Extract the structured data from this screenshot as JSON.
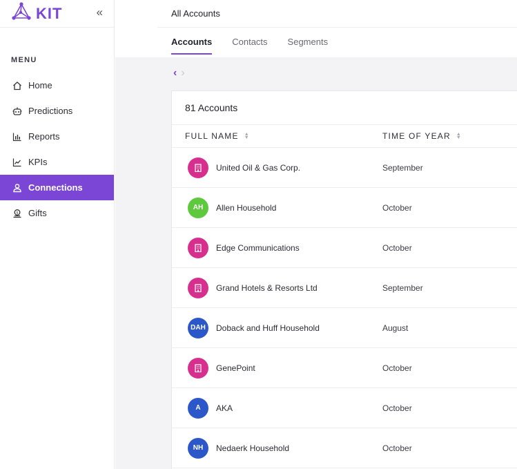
{
  "brand": {
    "name": "KIT",
    "collapse_glyph": "«"
  },
  "sidebar": {
    "menu_title": "MENU",
    "items": [
      {
        "label": "Home",
        "icon": "home-icon"
      },
      {
        "label": "Predictions",
        "icon": "robot-icon"
      },
      {
        "label": "Reports",
        "icon": "bar-chart-icon"
      },
      {
        "label": "KPIs",
        "icon": "trend-line-icon"
      },
      {
        "label": "Connections",
        "icon": "user-icon",
        "active": true
      },
      {
        "label": "Gifts",
        "icon": "gift-icon"
      }
    ]
  },
  "header": {
    "title": "All Accounts",
    "tabs": [
      {
        "label": "Accounts",
        "active": true
      },
      {
        "label": "Contacts"
      },
      {
        "label": "Segments"
      }
    ]
  },
  "pager": {
    "prev": "‹",
    "next": "›"
  },
  "table": {
    "title": "81 Accounts",
    "columns": {
      "name": "FULL NAME",
      "time": "TIME OF YEAR"
    },
    "rows": [
      {
        "name": "United Oil & Gas Corp.",
        "time": "September",
        "avatar": "",
        "avatar_type": "account"
      },
      {
        "name": "Allen Household",
        "time": "October",
        "avatar": "AH",
        "avatar_type": "green"
      },
      {
        "name": "Edge Communications",
        "time": "October",
        "avatar": "",
        "avatar_type": "account"
      },
      {
        "name": "Grand Hotels & Resorts Ltd",
        "time": "September",
        "avatar": "",
        "avatar_type": "account"
      },
      {
        "name": "Doback and Huff Household",
        "time": "August",
        "avatar": "DAH",
        "avatar_type": "blue"
      },
      {
        "name": "GenePoint",
        "time": "October",
        "avatar": "",
        "avatar_type": "account"
      },
      {
        "name": "AKA",
        "time": "October",
        "avatar": "A",
        "avatar_type": "blue"
      },
      {
        "name": "Nedaerk Household",
        "time": "October",
        "avatar": "NH",
        "avatar_type": "blue"
      }
    ]
  },
  "colors": {
    "accent": "#7b46d6",
    "account": "#d62f8e",
    "green": "#5ec93d",
    "blue": "#2b57c9"
  }
}
